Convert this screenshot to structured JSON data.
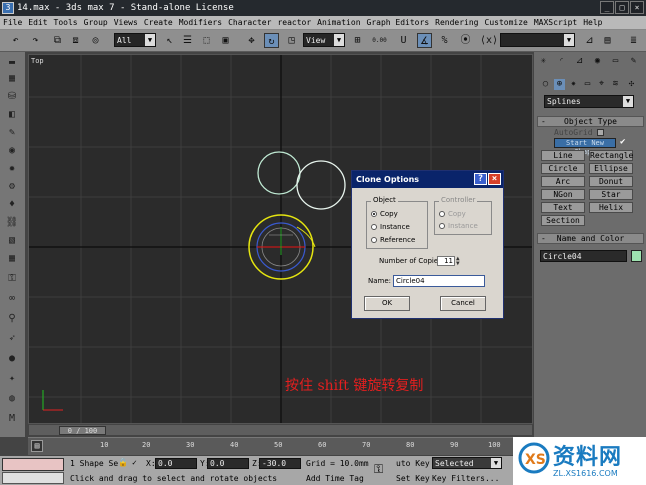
{
  "window": {
    "title": "14.max - 3ds max 7 - Stand-alone License",
    "minimize": "_",
    "maximize": "□",
    "close": "×"
  },
  "menu": [
    "File",
    "Edit",
    "Tools",
    "Group",
    "Views",
    "Create",
    "Modifiers",
    "Character",
    "reactor",
    "Animation",
    "Graph Editors",
    "Rendering",
    "Customize",
    "MAXScript",
    "Help"
  ],
  "toolbar": {
    "selection_filter": "All",
    "ref_coord": "View",
    "snap_value": "0.00",
    "named_sel": ""
  },
  "viewport": {
    "label": "Top"
  },
  "command_panel": {
    "category": "Splines",
    "object_type_header": "Object Type",
    "autogrid": "AutoGrid",
    "start_new_shape": "Start New Shape",
    "buttons": [
      "Line",
      "Rectangle",
      "Circle",
      "Ellipse",
      "Arc",
      "Donut",
      "NGon",
      "Star",
      "Text",
      "Helix",
      "Section"
    ],
    "name_color_header": "Name and Color",
    "object_name": "Circle04",
    "object_color": "#9ee3b0"
  },
  "dialog": {
    "title": "Clone Options",
    "object_group": "Object",
    "object_options": [
      "Copy",
      "Instance",
      "Reference"
    ],
    "controller_group": "Controller",
    "controller_options": [
      "Copy",
      "Instance"
    ],
    "copies_label": "Number of Copies:",
    "copies_value": "11",
    "name_label": "Name:",
    "name_value": "Circle04",
    "ok": "OK",
    "cancel": "Cancel"
  },
  "caption": "按住 shift 键旋转复制",
  "timeslider": {
    "position": "0 / 100"
  },
  "trackbar_ticks": [
    "10",
    "20",
    "30",
    "40",
    "50",
    "60",
    "70",
    "80",
    "90",
    "100"
  ],
  "status": {
    "selection": "1 Shape Se",
    "x_label": "X:",
    "x_value": "0.0",
    "y_label": "Y:",
    "y_value": "0.0",
    "z_label": "Z:",
    "z_value": "-30.0",
    "grid": "Grid = 10.0mm",
    "auto_key": "uto Key",
    "selected": "Selected",
    "set_key": "Set Key",
    "key_filters": "Key Filters...",
    "prompt": "Click and drag to select and rotate objects",
    "add_time_tag": "Add Time Tag"
  },
  "watermark": {
    "brand": "资料网",
    "url": "ZL.XS1616.COM"
  }
}
